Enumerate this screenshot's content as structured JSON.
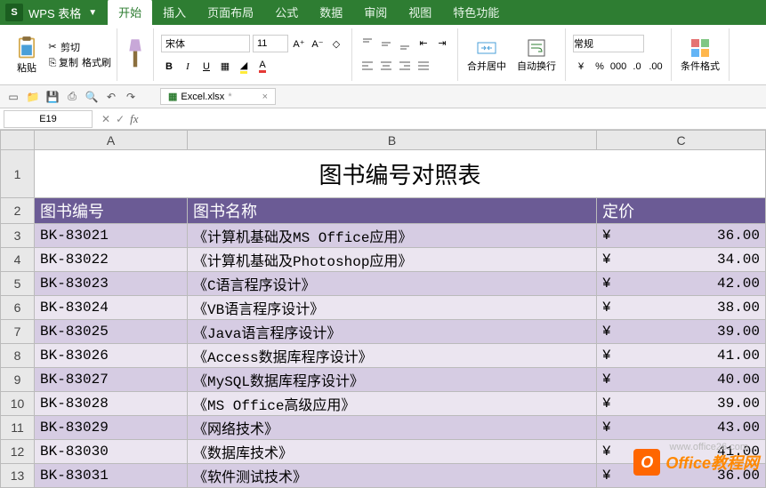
{
  "app": {
    "name": "WPS 表格"
  },
  "tabs": [
    "开始",
    "插入",
    "页面布局",
    "公式",
    "数据",
    "审阅",
    "视图",
    "特色功能"
  ],
  "ribbon": {
    "paste": "粘贴",
    "cut": "剪切",
    "copy": "复制",
    "format_painter": "格式刷",
    "font_name": "宋体",
    "font_size": "11",
    "merge_center": "合并居中",
    "wrap_text": "自动换行",
    "number_format": "常规",
    "cond_format": "条件格式"
  },
  "file_tab": "Excel.xlsx",
  "cell_ref": "E19",
  "columns": [
    "A",
    "B",
    "C"
  ],
  "sheet": {
    "title": "图书编号对照表",
    "headers": {
      "code": "图书编号",
      "name": "图书名称",
      "price": "定价"
    },
    "currency": "¥",
    "rows": [
      {
        "code": "BK-83021",
        "name": "《计算机基础及MS Office应用》",
        "price": "36.00"
      },
      {
        "code": "BK-83022",
        "name": "《计算机基础及Photoshop应用》",
        "price": "34.00"
      },
      {
        "code": "BK-83023",
        "name": "《C语言程序设计》",
        "price": "42.00"
      },
      {
        "code": "BK-83024",
        "name": "《VB语言程序设计》",
        "price": "38.00"
      },
      {
        "code": "BK-83025",
        "name": "《Java语言程序设计》",
        "price": "39.00"
      },
      {
        "code": "BK-83026",
        "name": "《Access数据库程序设计》",
        "price": "41.00"
      },
      {
        "code": "BK-83027",
        "name": "《MySQL数据库程序设计》",
        "price": "40.00"
      },
      {
        "code": "BK-83028",
        "name": "《MS Office高级应用》",
        "price": "39.00"
      },
      {
        "code": "BK-83029",
        "name": "《网络技术》",
        "price": "43.00"
      },
      {
        "code": "BK-83030",
        "name": "《数据库技术》",
        "price": "41.00"
      },
      {
        "code": "BK-83031",
        "name": "《软件测试技术》",
        "price": "36.00"
      }
    ]
  },
  "watermark": {
    "brand": "Office教程网",
    "url": "www.office26.com"
  }
}
